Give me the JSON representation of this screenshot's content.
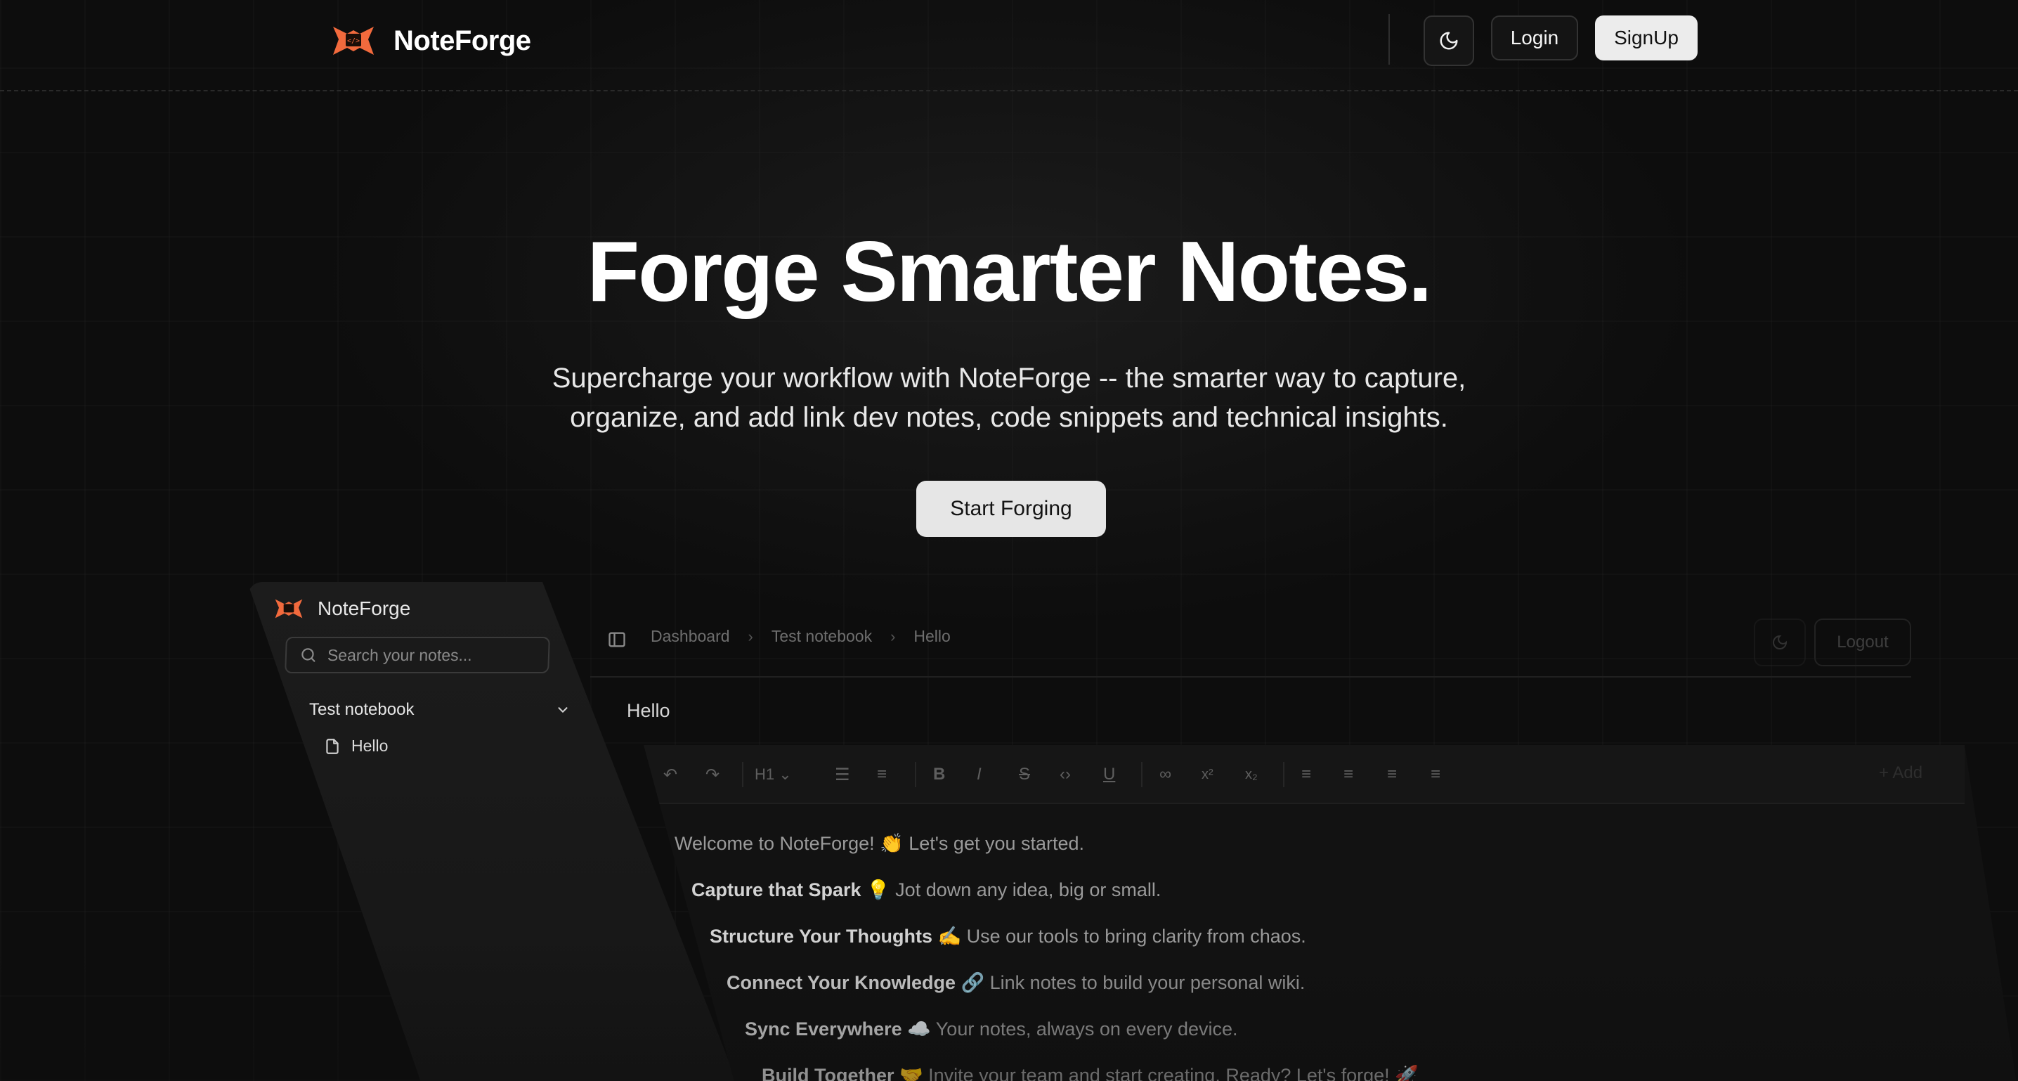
{
  "navbar": {
    "brand": "NoteForge",
    "login": "Login",
    "signup": "SignUp",
    "theme_icon": "moon-icon"
  },
  "hero": {
    "title": "Forge Smarter Notes.",
    "subtitle_line1": "Supercharge your workflow with NoteForge -- the smarter way to capture,",
    "subtitle_line2": "organize, and add link dev notes, code snippets and technical insights.",
    "cta": "Start Forging"
  },
  "preview": {
    "sidebar": {
      "brand": "NoteForge",
      "search_placeholder": "Search your notes...",
      "notebook": "Test notebook",
      "note": "Hello"
    },
    "header": {
      "breadcrumb": [
        "Dashboard",
        "Test notebook",
        "Hello"
      ],
      "logout": "Logout"
    },
    "note_title": "Hello",
    "toolbar": {
      "heading": "H1",
      "add": "+ Add"
    },
    "content": {
      "intro": "Welcome to NoteForge! 👏 Let's get you started.",
      "items": [
        {
          "bold": "Capture that Spark",
          "text": " 💡 Jot down any idea, big or small."
        },
        {
          "bold": "Structure Your Thoughts",
          "text": " ✍️ Use our tools to bring clarity from chaos."
        },
        {
          "bold": "Connect Your Knowledge",
          "text": " 🔗 Link notes to build your personal wiki."
        },
        {
          "bold": "Sync Everywhere",
          "text": " ☁️ Your notes, always on every device."
        },
        {
          "bold": "Build Together",
          "text": " 🤝 Invite your team and start creating. Ready? Let's forge! 🚀"
        }
      ]
    }
  },
  "colors": {
    "accent": "#f26a3d",
    "background": "#0d0d0d",
    "button_light": "#ececec"
  }
}
